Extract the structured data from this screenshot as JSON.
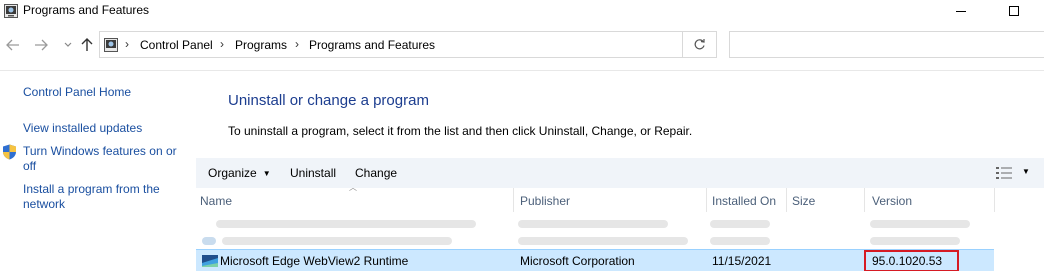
{
  "window": {
    "title": "Programs and Features",
    "minimize_glyph": "—",
    "maximize_glyph": "☐"
  },
  "address": {
    "crumbs": [
      "Control Panel",
      "Programs",
      "Programs and Features"
    ],
    "search_placeholder": ""
  },
  "left_pane": {
    "home": "Control Panel Home",
    "view_updates": "View installed updates",
    "windows_features_line1": "Turn Windows features on or",
    "windows_features_line2": "off",
    "install_network_line1": "Install a program from the",
    "install_network_line2": "network"
  },
  "main": {
    "heading": "Uninstall or change a program",
    "description": "To uninstall a program, select it from the list and then click Uninstall, Change, or Repair."
  },
  "toolbar": {
    "organize": "Organize",
    "uninstall": "Uninstall",
    "change": "Change"
  },
  "columns": {
    "name": "Name",
    "publisher": "Publisher",
    "installed_on": "Installed On",
    "size": "Size",
    "version": "Version"
  },
  "selected_row": {
    "name": "Microsoft Edge WebView2 Runtime",
    "publisher": "Microsoft Corporation",
    "installed_on": "11/15/2021",
    "size": "",
    "version": "95.0.1020.53"
  },
  "colors": {
    "link": "#1a4fa0",
    "heading": "#1c3d8f",
    "selection": "#cce8ff",
    "highlight_border": "#d61a23"
  },
  "icons": {
    "app": "control-panel-icon",
    "back": "back-arrow-icon",
    "forward": "forward-arrow-icon",
    "up": "up-arrow-icon",
    "refresh": "refresh-icon",
    "shield": "shield-icon",
    "view": "view-options-icon",
    "edge": "edge-webview-icon"
  }
}
